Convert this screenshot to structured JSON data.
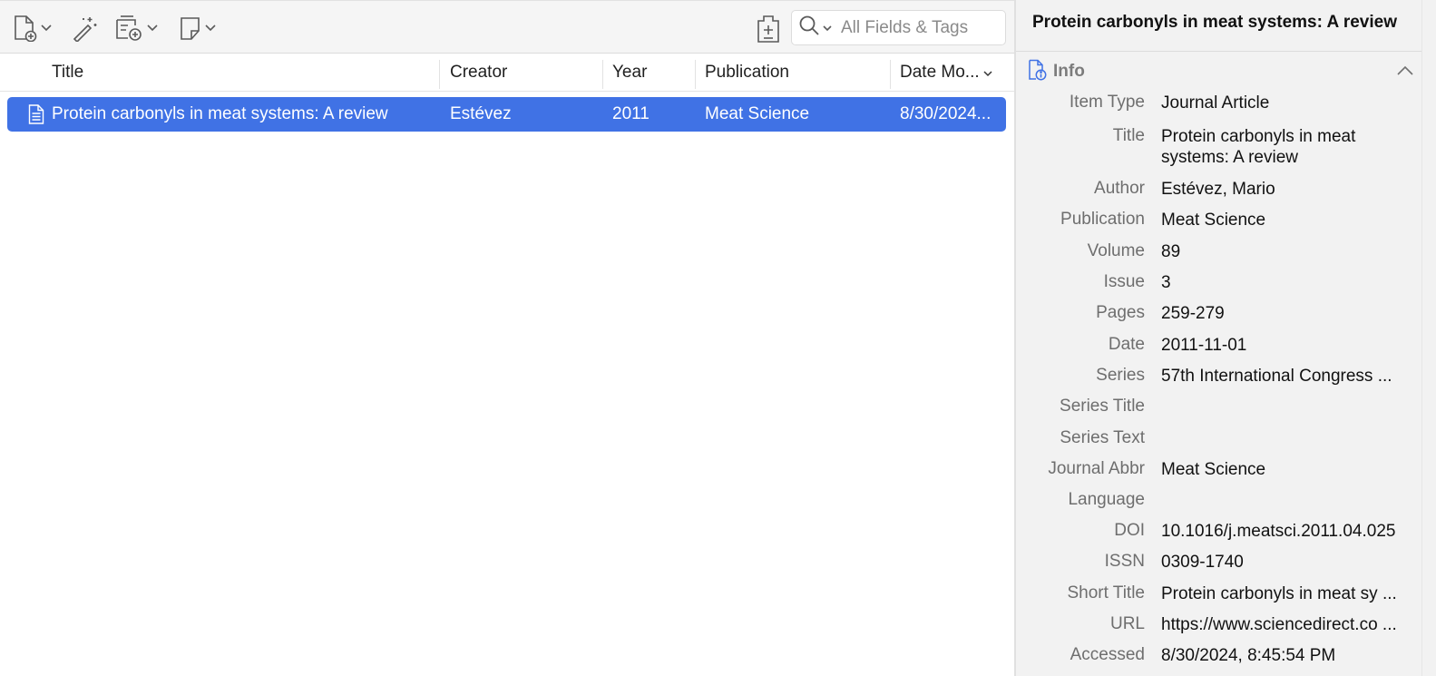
{
  "toolbar": {
    "new_item_icon": "new-item-icon",
    "magic_wand_icon": "add-by-identifier-icon",
    "attachment_icon": "add-attachment-icon",
    "note_icon": "new-note-icon",
    "sync_icon": "locate-icon"
  },
  "search": {
    "placeholder": "All Fields & Tags"
  },
  "columns": {
    "title": "Title",
    "creator": "Creator",
    "year": "Year",
    "publication": "Publication",
    "date_modified": "Date Mo..."
  },
  "items": [
    {
      "title": "Protein carbonyls in meat systems: A review",
      "creator": "Estévez",
      "year": "2011",
      "publication": "Meat Science",
      "date_modified": "8/30/2024..."
    }
  ],
  "item_pane": {
    "header_title": "Protein carbonyls in meat systems: A review",
    "section_label": "Info",
    "fields": [
      {
        "label": "Item Type",
        "value": "Journal Article"
      },
      {
        "label": "Title",
        "value": "Protein carbonyls in meat systems: A review"
      },
      {
        "label": "Author",
        "value": "Estévez, Mario"
      },
      {
        "label": "Publication",
        "value": "Meat Science"
      },
      {
        "label": "Volume",
        "value": "89"
      },
      {
        "label": "Issue",
        "value": "3"
      },
      {
        "label": "Pages",
        "value": "259-279"
      },
      {
        "label": "Date",
        "value": "2011-11-01"
      },
      {
        "label": "Series",
        "value": "57th International Congress ..."
      },
      {
        "label": "Series Title",
        "value": ""
      },
      {
        "label": "Series Text",
        "value": ""
      },
      {
        "label": "Journal Abbr",
        "value": "Meat Science"
      },
      {
        "label": "Language",
        "value": ""
      },
      {
        "label": "DOI",
        "value": "10.1016/j.meatsci.2011.04.025"
      },
      {
        "label": "ISSN",
        "value": "0309-1740"
      },
      {
        "label": "Short Title",
        "value": "Protein carbonyls in meat sy ..."
      },
      {
        "label": "URL",
        "value": "https://www.sciencedirect.co ..."
      },
      {
        "label": "Accessed",
        "value": "8/30/2024, 8:45:54 PM"
      }
    ]
  },
  "colors": {
    "selection": "#4072e5",
    "toolbar_bg": "#f5f5f5",
    "pane_bg": "#f2f2f2"
  }
}
